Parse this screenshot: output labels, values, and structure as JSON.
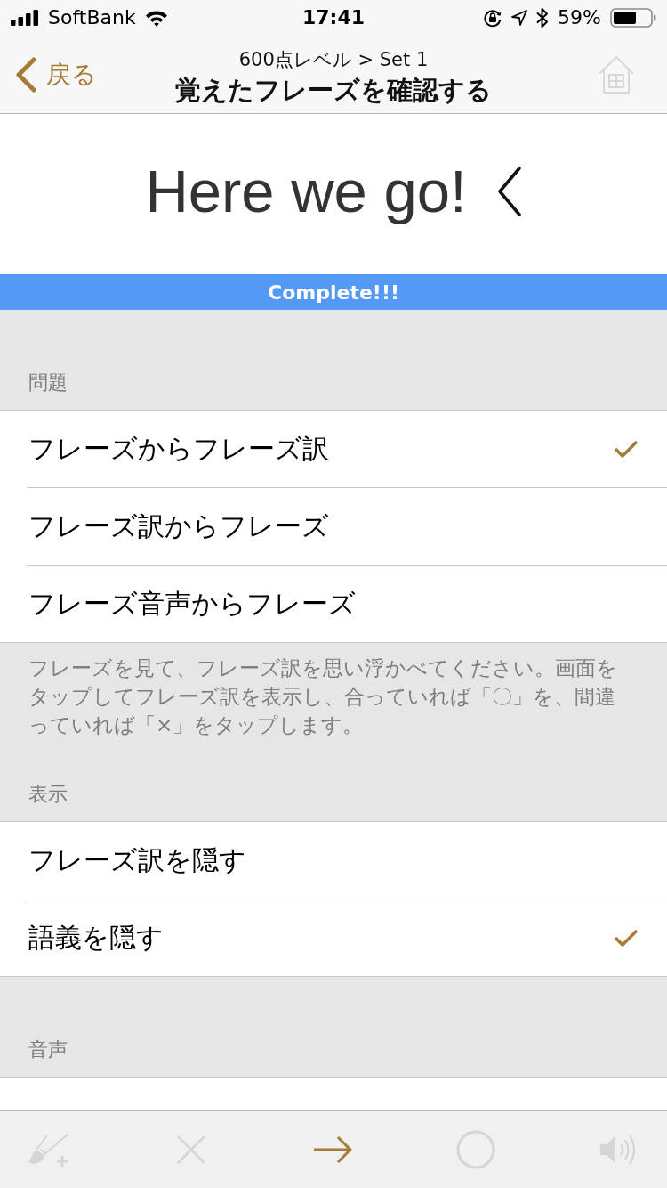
{
  "status_bar": {
    "carrier": "SoftBank",
    "time": "17:41",
    "battery": "59%"
  },
  "nav": {
    "back": "戻る",
    "subtitle": "600点レベル > Set 1",
    "title": "覚えたフレーズを確認する"
  },
  "prompt": {
    "text": "Here we go!"
  },
  "banner": {
    "text": "Complete!!!"
  },
  "sections": [
    {
      "header": "問題",
      "items": [
        {
          "kind": "option",
          "label": "フレーズからフレーズ訳",
          "selected": true
        },
        {
          "kind": "option",
          "label": "フレーズ訳からフレーズ",
          "selected": false
        },
        {
          "kind": "option",
          "label": "フレーズ音声からフレーズ",
          "selected": false
        }
      ],
      "footer": "フレーズを見て、フレーズ訳を思い浮かべてください。画面をタップしてフレーズ訳を表示し、合っていれば「〇」を、間違っていれば「×」をタップします。"
    },
    {
      "header": "表示",
      "items": [
        {
          "kind": "toggle",
          "label": "フレーズ訳を隠す",
          "checked": false
        },
        {
          "kind": "toggle",
          "label": "語義を隠す",
          "checked": true
        }
      ]
    },
    {
      "header": "音声"
    }
  ],
  "toolbar": [
    {
      "kind": "highlight",
      "disabled": true
    },
    {
      "kind": "wrong",
      "disabled": true
    },
    {
      "kind": "next",
      "disabled": false
    },
    {
      "kind": "correct",
      "disabled": true
    },
    {
      "kind": "audio",
      "disabled": true
    }
  ]
}
